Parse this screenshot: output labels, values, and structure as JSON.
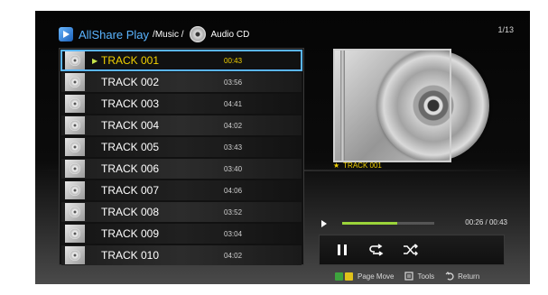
{
  "page_counter": "1/13",
  "header": {
    "app_title": "AllShare Play",
    "path_music": "/Music /",
    "location": "Audio CD"
  },
  "tracks": [
    {
      "name": "TRACK 001",
      "time": "00:43",
      "selected": true
    },
    {
      "name": "TRACK 002",
      "time": "03:56"
    },
    {
      "name": "TRACK 003",
      "time": "04:41"
    },
    {
      "name": "TRACK 004",
      "time": "04:02"
    },
    {
      "name": "TRACK 005",
      "time": "03:43"
    },
    {
      "name": "TRACK 006",
      "time": "03:40"
    },
    {
      "name": "TRACK 007",
      "time": "04:06"
    },
    {
      "name": "TRACK 008",
      "time": "03:52"
    },
    {
      "name": "TRACK 009",
      "time": "03:04"
    },
    {
      "name": "TRACK 010",
      "time": "04:02"
    }
  ],
  "now_playing": {
    "title": "TRACK 001",
    "elapsed_time": "00:26 / 00:43",
    "progress": 0.6
  },
  "colors": {
    "accent": "#5ab4ff",
    "selected_text": "#f2d100",
    "progress": "#9bd43a"
  },
  "icons": {
    "play_indicator": "play-triangle-icon",
    "pause": "pause-icon",
    "repeat": "repeat-icon",
    "shuffle": "shuffle-icon"
  },
  "footer": {
    "page_move": "Page Move",
    "tools": "Tools",
    "return": "Return"
  }
}
